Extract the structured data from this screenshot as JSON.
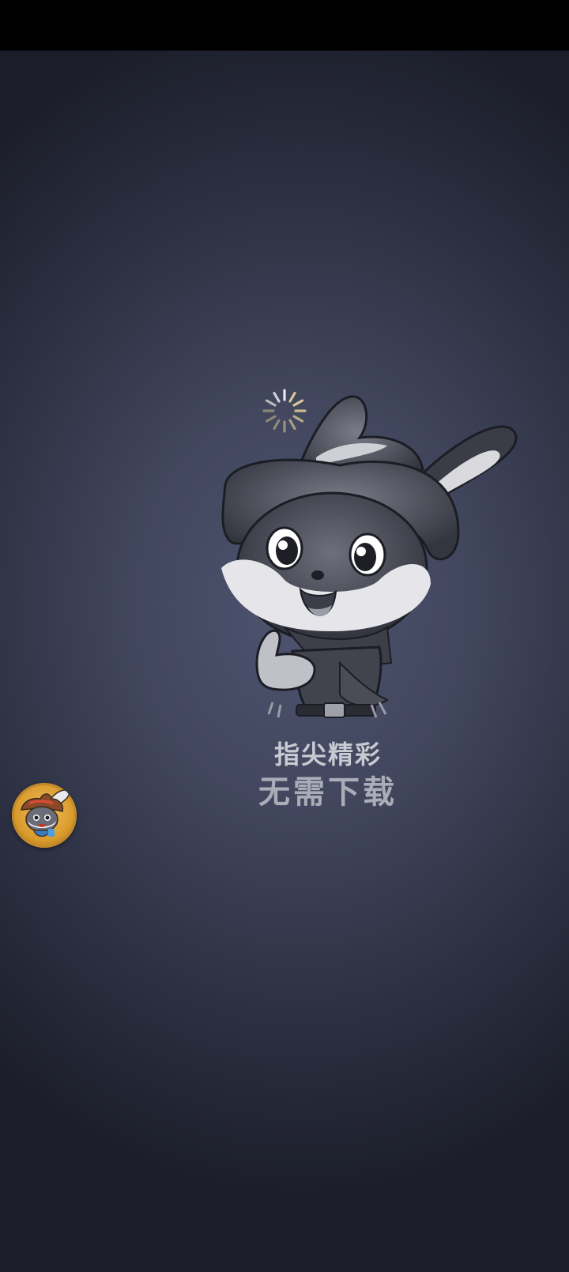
{
  "slogan": {
    "line1": "指尖精彩",
    "line2": "无需下载"
  },
  "icons": {
    "loading": "loading-spinner-icon",
    "mascot": "rabbit-cowboy-mascot",
    "floating": "floating-mascot-icon"
  },
  "colors": {
    "background_center": "#4f5470",
    "background_edge": "#1b1d29",
    "status_bar": "#000000",
    "float_ball": "#d99a2b"
  }
}
